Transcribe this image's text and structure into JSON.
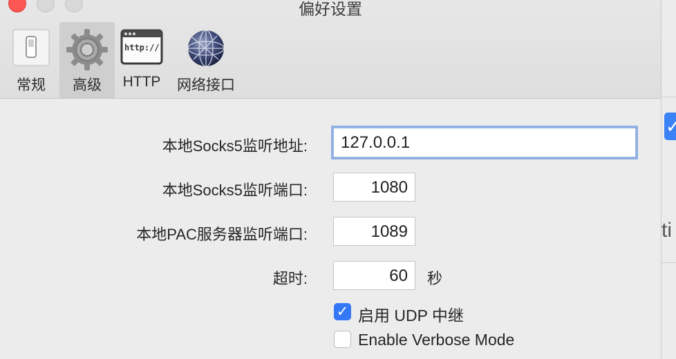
{
  "window": {
    "title": "偏好设置"
  },
  "toolbar": {
    "items": [
      {
        "label": "常规",
        "icon": "switch-icon"
      },
      {
        "label": "高级",
        "icon": "gear-icon",
        "selected": true
      },
      {
        "label": "HTTP",
        "icon": "http-window-icon",
        "icon_text": "http://"
      },
      {
        "label": "网络接口",
        "icon": "globe-network-icon"
      }
    ]
  },
  "form": {
    "socks_addr": {
      "label": "本地Socks5监听地址:",
      "value": "127.0.0.1"
    },
    "socks_port": {
      "label": "本地Socks5监听端口:",
      "value": "1080"
    },
    "pac_port": {
      "label": "本地PAC服务器监听端口:",
      "value": "1089"
    },
    "timeout": {
      "label": "超时:",
      "value": "60",
      "unit": "秒"
    },
    "udp_relay": {
      "label": "启用 UDP 中继",
      "checked": true
    },
    "verbose": {
      "label": "Enable Verbose Mode",
      "checked": false
    }
  },
  "background_window": {
    "partial_text": "ti"
  },
  "colors": {
    "accent": "#3478f6",
    "close": "#fc5753",
    "focus_ring": "#8fb0e4"
  }
}
